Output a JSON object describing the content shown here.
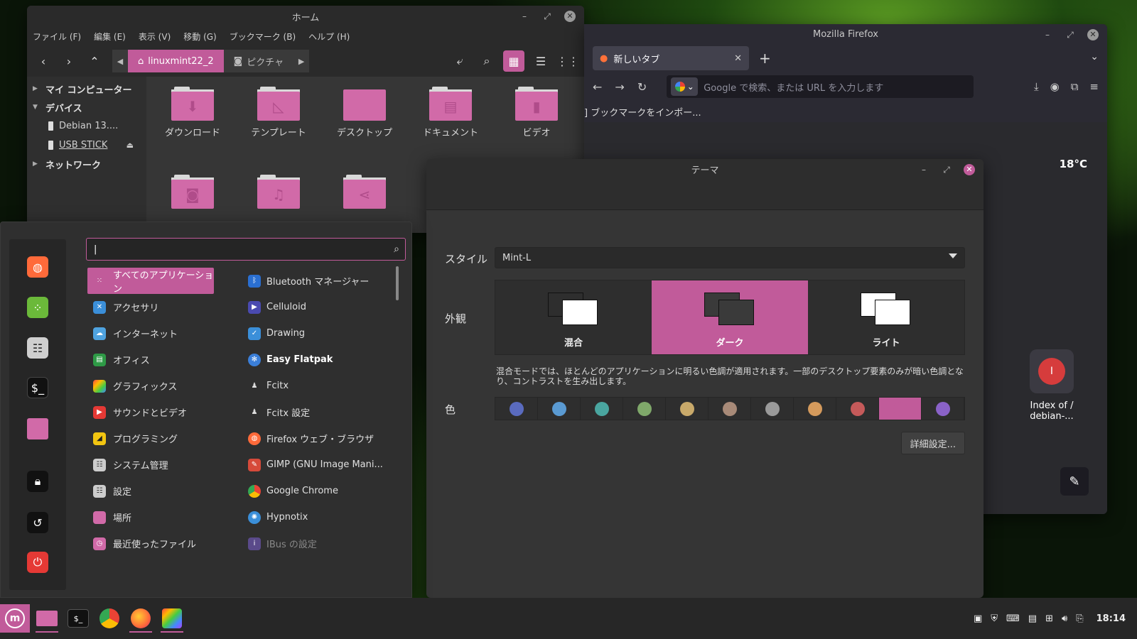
{
  "nemo": {
    "title": "ホーム",
    "menu": [
      "ファイル (F)",
      "編集 (E)",
      "表示 (V)",
      "移動 (G)",
      "ブックマーク (B)",
      "ヘルプ (H)"
    ],
    "crumb_active": "linuxmint22_2",
    "crumb_next": "ピクチャ",
    "sidebar": {
      "my_computer": "マイ コンピューター",
      "devices": "デバイス",
      "device1": "Debian 13....",
      "device2": "USB STICK",
      "network": "ネットワーク"
    },
    "folders": [
      "ダウンロード",
      "テンプレート",
      "デスクトップ",
      "ドキュメント",
      "ビデオ"
    ]
  },
  "firefox": {
    "title": "Mozilla Firefox",
    "tab_label": "新しいタブ",
    "url_placeholder": "Google で検索、または URL を入力します",
    "bookmark_import": "] ブックマークをインポー...",
    "temperature": "18°C",
    "shortcut_label": "Index of /\ndebian-..."
  },
  "themes": {
    "title": "テーマ",
    "style_label": "スタイル",
    "style_value": "Mint-L",
    "appearance_label": "外観",
    "mode_mixed": "混合",
    "mode_dark": "ダーク",
    "mode_light": "ライト",
    "description": "混合モードでは、ほとんどのアプリケーションに明るい色調が適用されます。一部のデスクトップ要素のみが暗い色調となり、コントラストを生み出します。",
    "color_label": "色",
    "swatches": [
      "#5a6bbf",
      "#5a9ad2",
      "#4aa6a0",
      "#7fa86a",
      "#c8a96a",
      "#a88a78",
      "#9a9a9a",
      "#d49a5c",
      "#c55a5a",
      "#c15b9a",
      "#8a62c8"
    ],
    "advanced_button": "詳細設定..."
  },
  "menu": {
    "search_value": "|",
    "categories": [
      "すべてのアプリケーション",
      "アクセサリ",
      "インターネット",
      "オフィス",
      "グラフィックス",
      "サウンドとビデオ",
      "プログラミング",
      "システム管理",
      "設定",
      "場所",
      "最近使ったファイル"
    ],
    "apps": [
      "Bluetooth マネージャー",
      "Celluloid",
      "Drawing",
      "Easy Flatpak",
      "Fcitx",
      "Fcitx 設定",
      "Firefox ウェブ・ブラウザ",
      "GIMP (GNU Image Mani...",
      "Google Chrome",
      "Hypnotix",
      "IBus の設定"
    ]
  },
  "taskbar": {
    "clock": "18:14"
  },
  "colors": {
    "accent": "#c15b9a"
  }
}
